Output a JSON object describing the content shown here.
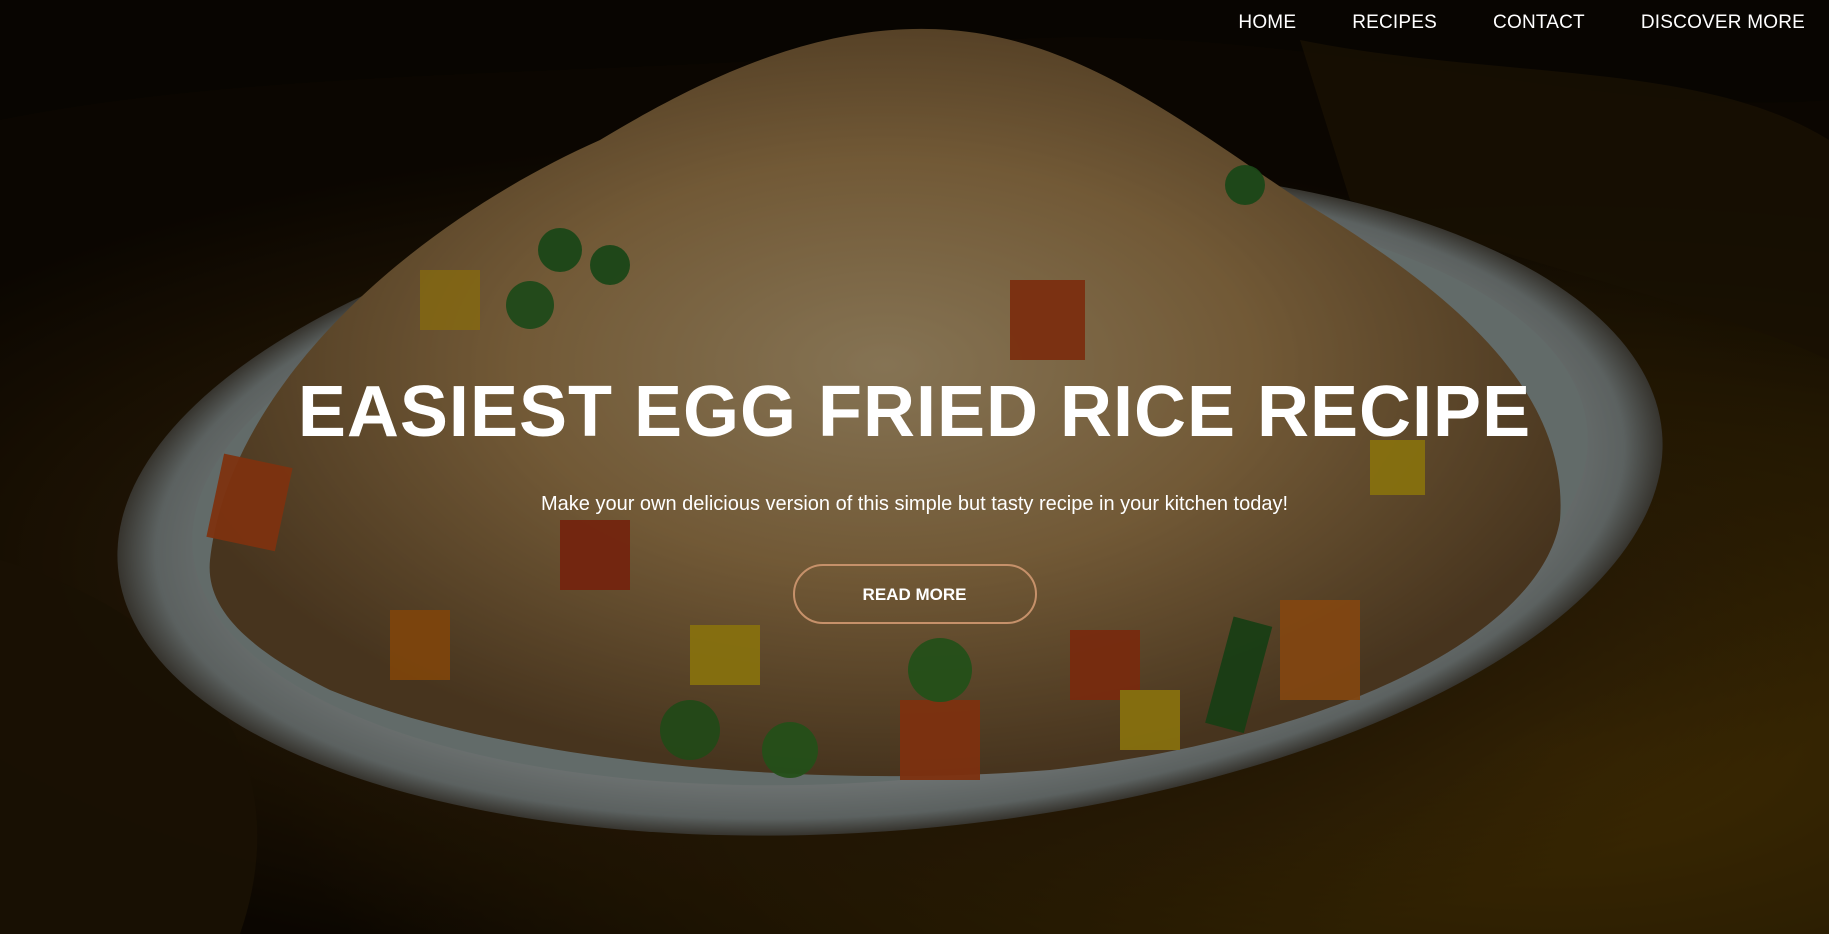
{
  "nav": {
    "items": [
      {
        "label": "HOME"
      },
      {
        "label": "RECIPES"
      },
      {
        "label": "CONTACT"
      },
      {
        "label": "DISCOVER MORE"
      }
    ]
  },
  "hero": {
    "title": "EASIEST EGG FRIED RICE RECIPE",
    "subtitle": "Make your own delicious version of this simple but tasty recipe in your kitchen today!",
    "cta_label": "READ MORE",
    "background_image": "egg-fried-rice-plate-photo"
  },
  "colors": {
    "text": "#ffffff",
    "cta_border": "#c6916a",
    "cloth": "#6b4a05"
  }
}
